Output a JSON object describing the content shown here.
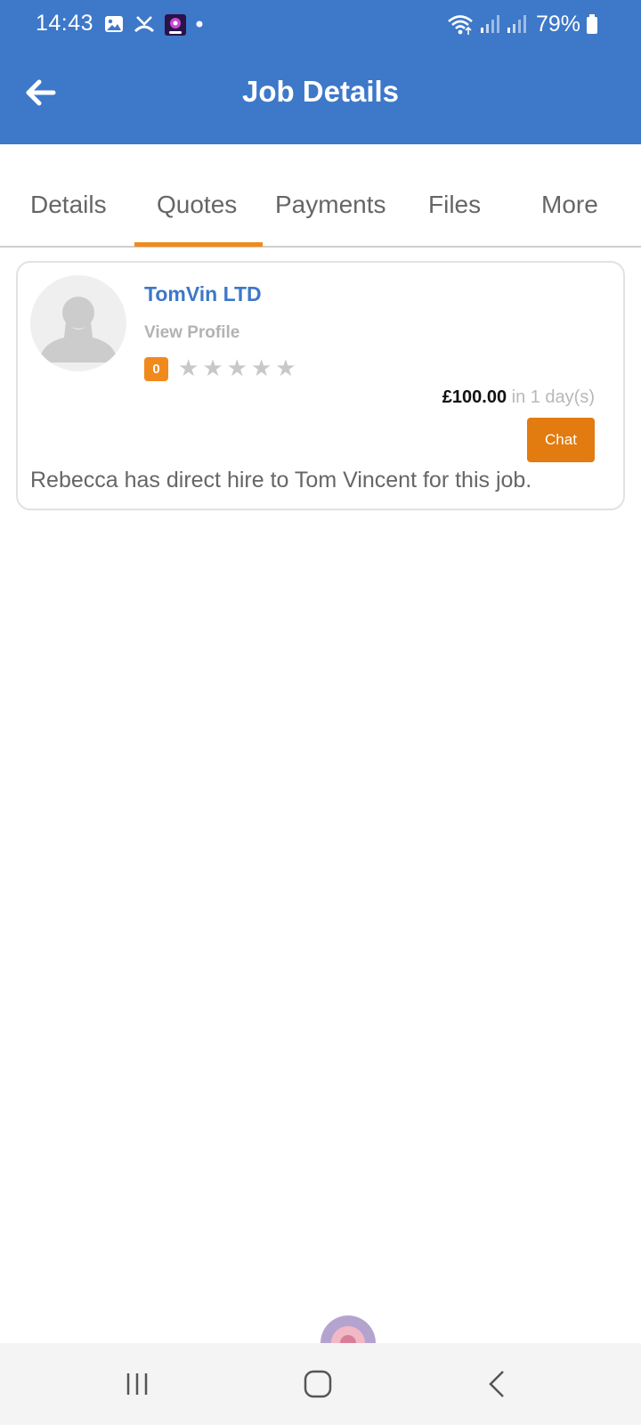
{
  "status_bar": {
    "time": "14:43",
    "battery": "79%",
    "icons": [
      "gallery-icon",
      "missed-call-icon",
      "app-notification-icon",
      "dot-icon",
      "wifi-icon",
      "signal-icon",
      "signal-icon",
      "battery-icon"
    ]
  },
  "app_bar": {
    "title": "Job Details",
    "back_icon": "arrow-left-icon",
    "color": "#3d78c9"
  },
  "tabs": [
    {
      "label": "Details",
      "active": false
    },
    {
      "label": "Quotes",
      "active": true
    },
    {
      "label": "Payments",
      "active": false
    },
    {
      "label": "Files",
      "active": false
    },
    {
      "label": "More",
      "active": false
    }
  ],
  "quote": {
    "company": "TomVin LTD",
    "view_profile": "View Profile",
    "rating_count": "0",
    "stars_filled": 0,
    "stars_total": 5,
    "price": "£100.00",
    "duration": "in 1 day(s)",
    "chat_label": "Chat",
    "message": "Rebecca has direct hire to Tom Vincent for this job."
  },
  "colors": {
    "accent": "#f08a1c",
    "chat_button": "#e27b10",
    "link": "#3d78c9"
  },
  "nav_bar": {
    "icons": [
      "recents-icon",
      "home-icon",
      "back-icon"
    ]
  }
}
